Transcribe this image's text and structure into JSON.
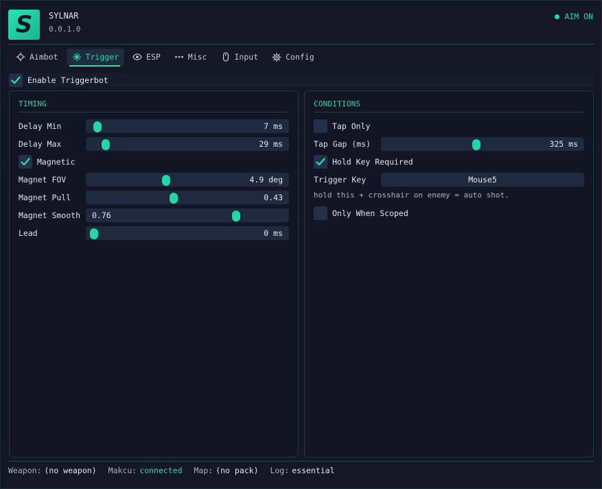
{
  "app": {
    "logo_letter": "S",
    "name": "SYLNAR",
    "version": "0.0.1.0"
  },
  "aim_status": "AIM ON",
  "colors": {
    "accent": "#2fd6a6",
    "background": "#131726",
    "control": "#1f2a3f"
  },
  "tabs": [
    {
      "label": "Aimbot",
      "icon": "crosshair-icon",
      "active": false
    },
    {
      "label": "Trigger",
      "icon": "snowflake-icon",
      "active": true
    },
    {
      "label": "ESP",
      "icon": "eye-icon",
      "active": false
    },
    {
      "label": "Misc",
      "icon": "dots-icon",
      "active": false
    },
    {
      "label": "Input",
      "icon": "mouse-icon",
      "active": false
    },
    {
      "label": "Config",
      "icon": "gear-icon",
      "active": false
    }
  ],
  "enable_triggerbot": {
    "label": "Enable Triggerbot",
    "checked": true
  },
  "timing": {
    "title": "TIMING",
    "delay_min": {
      "label": "Delay Min",
      "value": "7 ms",
      "fraction": 0.04
    },
    "delay_max": {
      "label": "Delay Max",
      "value": "29 ms",
      "fraction": 0.08
    },
    "magnetic": {
      "label": "Magnetic",
      "checked": true
    },
    "magnet_fov": {
      "label": "Magnet FOV",
      "value": "4.9 deg",
      "fraction": 0.39
    },
    "magnet_pull": {
      "label": "Magnet Pull",
      "value": "0.43",
      "fraction": 0.43
    },
    "magnet_smooth": {
      "label": "Magnet Smooth",
      "value": "0.76",
      "fraction": 0.75
    },
    "lead": {
      "label": "Lead",
      "value": "0 ms",
      "fraction": 0.02
    }
  },
  "conditions": {
    "title": "CONDITIONS",
    "tap_only": {
      "label": "Tap Only",
      "checked": false
    },
    "tap_gap": {
      "label": "Tap Gap (ms)",
      "value": "325 ms",
      "fraction": 0.47
    },
    "hold_key_required": {
      "label": "Hold Key Required",
      "checked": true
    },
    "trigger_key": {
      "label": "Trigger Key",
      "value": "Mouse5"
    },
    "hint": "hold this + crosshair on enemy = auto shot.",
    "only_when_scoped": {
      "label": "Only When Scoped",
      "checked": false
    }
  },
  "status_bar": {
    "weapon_label": "Weapon:",
    "weapon_value": "(no weapon)",
    "makcu_label": "Makcu:",
    "makcu_value": "connected",
    "map_label": "Map:",
    "map_value": "(no pack)",
    "log_label": "Log:",
    "log_value": "essential"
  }
}
